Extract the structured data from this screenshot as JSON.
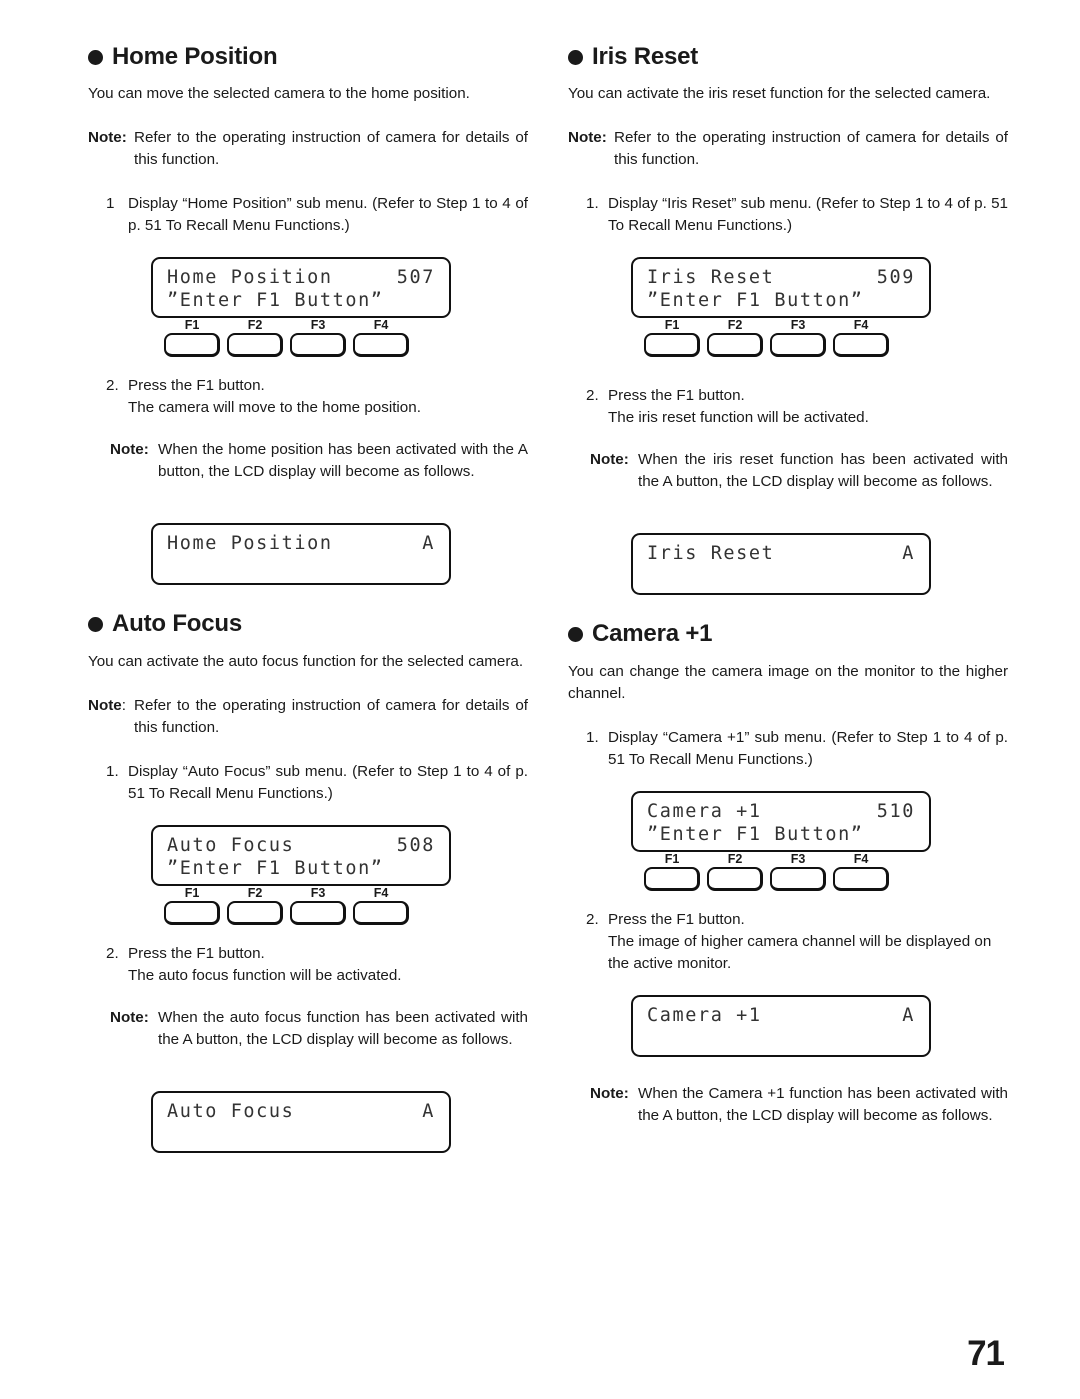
{
  "page": {
    "number": "71"
  },
  "left_column": {
    "sections": [
      {
        "heading": "Home Position",
        "intro": "You can move the selected camera to the home position.",
        "note1_label": "Note:",
        "note1_text": "Refer to the operating instruction of camera for details of this function.",
        "step1_num": "1",
        "step1_text": "Display “Home Position” sub menu. (Refer to Step 1 to 4 of p. 51 To Recall Menu Functions.)",
        "lcd1_line1_left": "Home Position",
        "lcd1_line1_right": "507",
        "lcd1_line2": "”Enter F1 Button”",
        "fkeys": [
          "F1",
          "F2",
          "F3",
          "F4"
        ],
        "step2_num": "2.",
        "step2_line1": "Press the F1 button.",
        "step2_line2": "The camera will move to the home position.",
        "note2_label": "Note:",
        "note2_text": "When the home position has been activated with the A button, the LCD display will become as follows.",
        "lcd2_line1_left": "Home Position",
        "lcd2_line1_right": "A"
      },
      {
        "heading": "Auto Focus",
        "intro": "You can activate the auto focus function for the selected camera.",
        "note1_label": "Note",
        "note1_colon": ":",
        "note1_text": "Refer to the operating instruction of camera for details of this function.",
        "step1_num": "1.",
        "step1_text": "Display “Auto Focus” sub menu. (Refer to Step 1 to 4 of p. 51 To Recall Menu Functions.)",
        "lcd1_line1_left": "Auto Focus",
        "lcd1_line1_right": "508",
        "lcd1_line2": "”Enter F1 Button”",
        "fkeys": [
          "F1",
          "F2",
          "F3",
          "F4"
        ],
        "step2_num": "2.",
        "step2_line1": "Press the F1 button.",
        "step2_line2": "The auto focus function will be activated.",
        "note2_label": "Note:",
        "note2_text": "When the auto focus function has been activated with the A button, the LCD display will become as follows.",
        "lcd2_line1_left": "Auto Focus",
        "lcd2_line1_right": "A"
      }
    ]
  },
  "right_column": {
    "sections": [
      {
        "heading": "Iris Reset",
        "intro": "You can activate the iris reset function for the selected camera.",
        "note1_label": "Note:",
        "note1_text": "Refer to the operating instruction of camera for details of this function.",
        "step1_num": "1.",
        "step1_text": "Display “Iris Reset” sub menu. (Refer to Step 1 to 4 of p. 51 To Recall Menu Functions.)",
        "lcd1_line1_left": "Iris Reset",
        "lcd1_line1_right": "509",
        "lcd1_line2": "”Enter F1 Button”",
        "fkeys": [
          "F1",
          "F2",
          "F3",
          "F4"
        ],
        "step2_num": "2.",
        "step2_line1": "Press the F1 button.",
        "step2_line2": "The iris reset function will be activated.",
        "note2_label": "Note:",
        "note2_text": "When the iris reset function has been activated with the A button, the LCD display will become as follows.",
        "lcd2_line1_left": "Iris Reset",
        "lcd2_line1_right": "A"
      },
      {
        "heading": "Camera +1",
        "intro": "You can change the camera image on the monitor to the higher channel.",
        "step1_num": "1.",
        "step1_text": "Display “Camera +1” sub menu. (Refer to Step 1 to 4 of p. 51 To Recall Menu Functions.)",
        "lcd1_line1_left": "Camera +1",
        "lcd1_line1_right": "510",
        "lcd1_line2": "”Enter F1 Button”",
        "fkeys": [
          "F1",
          "F2",
          "F3",
          "F4"
        ],
        "step2_num": "2.",
        "step2_line1": "Press the F1 button.",
        "step2_line2": "The image of higher camera channel will be displayed on the active monitor.",
        "lcd2_line1_left": "Camera +1",
        "lcd2_line1_right": "A",
        "note2_label": "Note:",
        "note2_text": "When the Camera +1 function has been activated with the A button, the LCD display will become as follows."
      }
    ]
  }
}
